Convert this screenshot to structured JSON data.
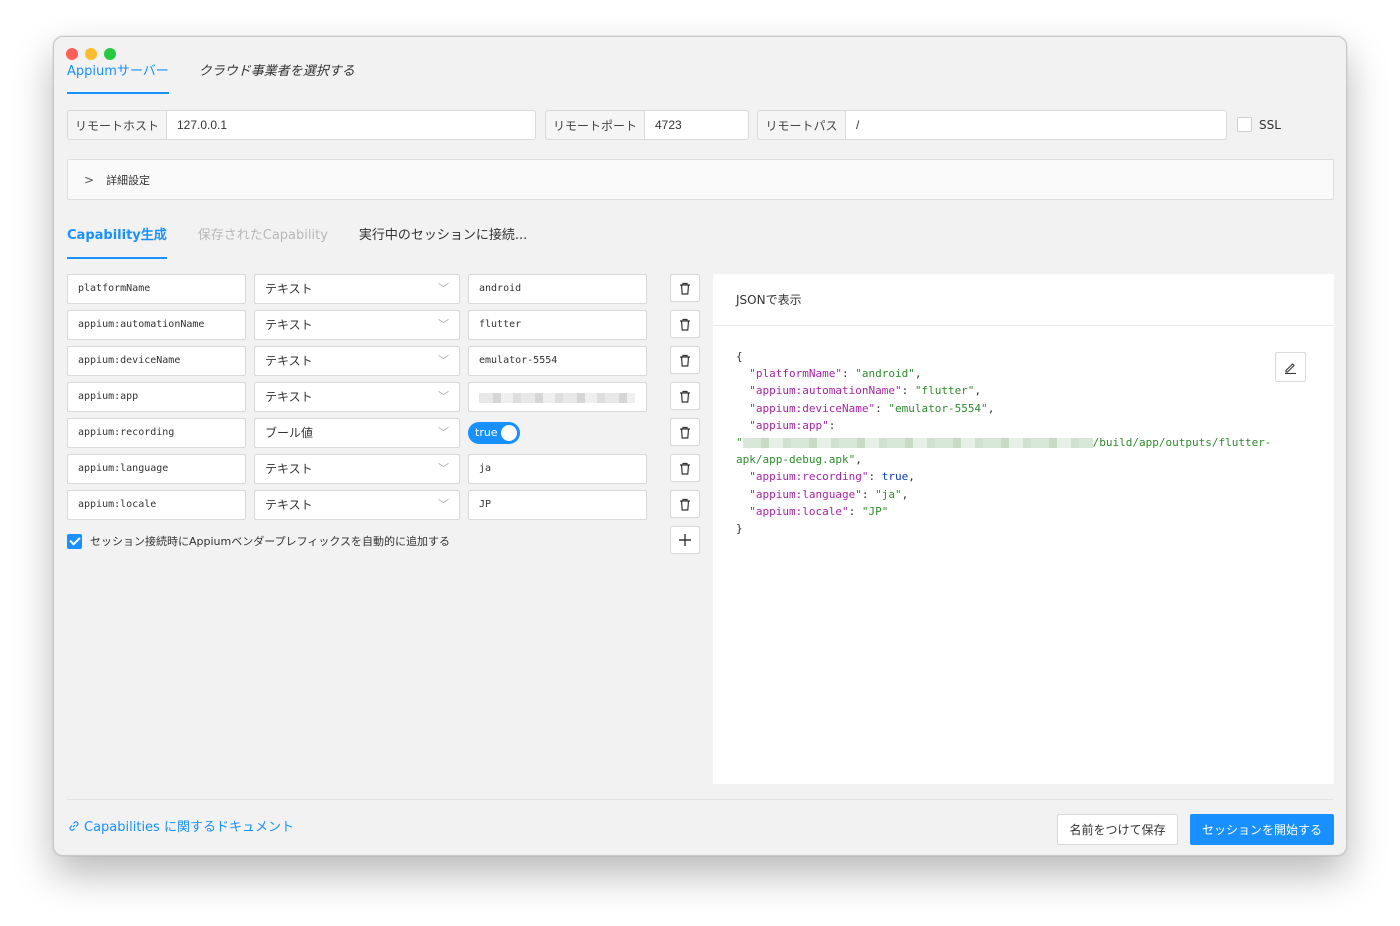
{
  "window": {
    "traffic_colors": [
      "#fe5f57",
      "#febc2e",
      "#28c840"
    ]
  },
  "top_tabs": [
    {
      "label": "Appiumサーバー",
      "active": true
    },
    {
      "label": "クラウド事業者を選択する",
      "active": false
    }
  ],
  "server": {
    "host_label": "リモートホスト",
    "host_value": "127.0.0.1",
    "port_label": "リモートポート",
    "port_value": "4723",
    "path_label": "リモートパス",
    "path_value": "/",
    "ssl_label": "SSL"
  },
  "advanced": {
    "label": "詳細設定"
  },
  "cap_tabs": [
    {
      "label": "Capability生成",
      "state": "active"
    },
    {
      "label": "保存されたCapability",
      "state": "disabled"
    },
    {
      "label": "実行中のセッションに接続...",
      "state": "normal"
    }
  ],
  "capabilities": [
    {
      "name": "platformName",
      "type": "テキスト",
      "value": "android"
    },
    {
      "name": "appium:automationName",
      "type": "テキスト",
      "value": "flutter"
    },
    {
      "name": "appium:deviceName",
      "type": "テキスト",
      "value": "emulator-5554"
    },
    {
      "name": "appium:app",
      "type": "テキスト",
      "value": ""
    },
    {
      "name": "appium:recording",
      "type": "ブール値",
      "value": "true"
    },
    {
      "name": "appium:language",
      "type": "テキスト",
      "value": "ja"
    },
    {
      "name": "appium:locale",
      "type": "テキスト",
      "value": "JP"
    }
  ],
  "prefix_checkbox": {
    "label": "セッション接続時にAppiumベンダープレフィックスを自動的に追加する",
    "checked": true
  },
  "json_panel": {
    "title": "JSONで表示",
    "lines": {
      "open": "{",
      "platformName_key": "\"platformName\"",
      "platformName_val": "\"android\"",
      "automationName_key": "\"appium:automationName\"",
      "automationName_val": "\"flutter\"",
      "deviceName_key": "\"appium:deviceName\"",
      "deviceName_val": "\"emulator-5554\"",
      "app_key": "\"appium:app\"",
      "app_val_start": "\"",
      "app_val_end": "/build/app/outputs/flutter-",
      "app_val_cont": "apk/app-debug.apk\"",
      "recording_key": "\"appium:recording\"",
      "recording_val": "true",
      "language_key": "\"appium:language\"",
      "language_val": "\"ja\"",
      "locale_key": "\"appium:locale\"",
      "locale_val": "\"JP\"",
      "close": "}"
    }
  },
  "footer": {
    "doc_link": "Capabilities に関するドキュメント",
    "save_label": "名前をつけて保存",
    "start_label": "セッションを開始する"
  },
  "colors": {
    "accent": "#1890ff",
    "json_key": "#a626a4",
    "json_string": "#2e8b2e",
    "json_bool": "#0e3bb8"
  }
}
